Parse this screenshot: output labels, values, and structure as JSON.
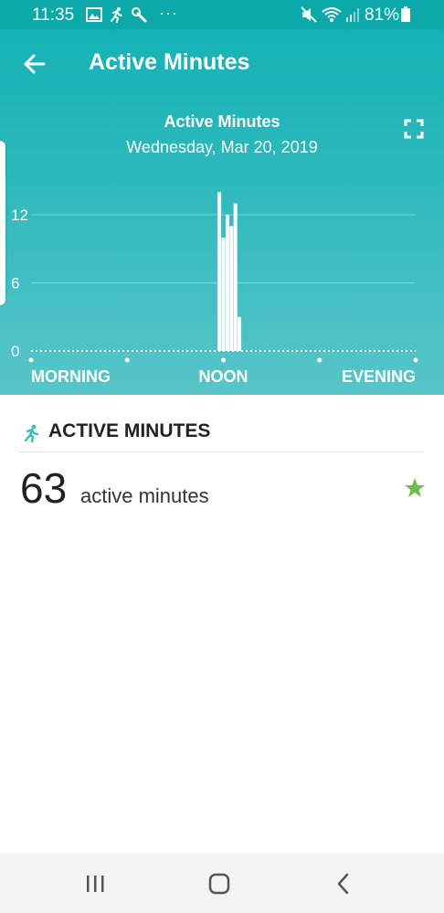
{
  "status_bar": {
    "time": "11:35",
    "icons_left": [
      "image-icon",
      "running-icon",
      "tool-icon",
      "more-dots-icon"
    ],
    "more_dots": "···",
    "icons_right": [
      "mute-icon",
      "wifi-icon",
      "signal-icon",
      "battery-icon"
    ],
    "battery_text": "81%"
  },
  "app_bar": {
    "title": "Active Minutes"
  },
  "chart_header": {
    "title": "Active Minutes",
    "date": "Wednesday, Mar 20, 2019"
  },
  "chart_data": {
    "type": "bar",
    "title": "Active Minutes",
    "y_ticks": [
      "12",
      "6",
      "0"
    ],
    "ylim": [
      0,
      15
    ],
    "x_labels": [
      "MORNING",
      "NOON",
      "EVENING"
    ],
    "x_range": [
      "00:00",
      "24:00"
    ],
    "bars": [
      {
        "time": "11:45",
        "value": 14
      },
      {
        "time": "12:00",
        "value": 10
      },
      {
        "time": "12:15",
        "value": 12
      },
      {
        "time": "12:30",
        "value": 11
      },
      {
        "time": "12:45",
        "value": 13
      },
      {
        "time": "13:00",
        "value": 3
      }
    ],
    "grid": true,
    "colors": {
      "bars": "#ffffff",
      "grid": "#ffffff"
    }
  },
  "summary": {
    "section_title": "ACTIVE MINUTES",
    "value": "63",
    "unit": "active minutes",
    "goal_icon": "star-icon",
    "star_color": "#6cc04a"
  },
  "colors": {
    "header_teal": "#0fb1b4",
    "accent": "#38bfc2"
  },
  "nav_bar": {
    "buttons": [
      "recent-apps-icon",
      "home-icon",
      "back-icon"
    ]
  }
}
